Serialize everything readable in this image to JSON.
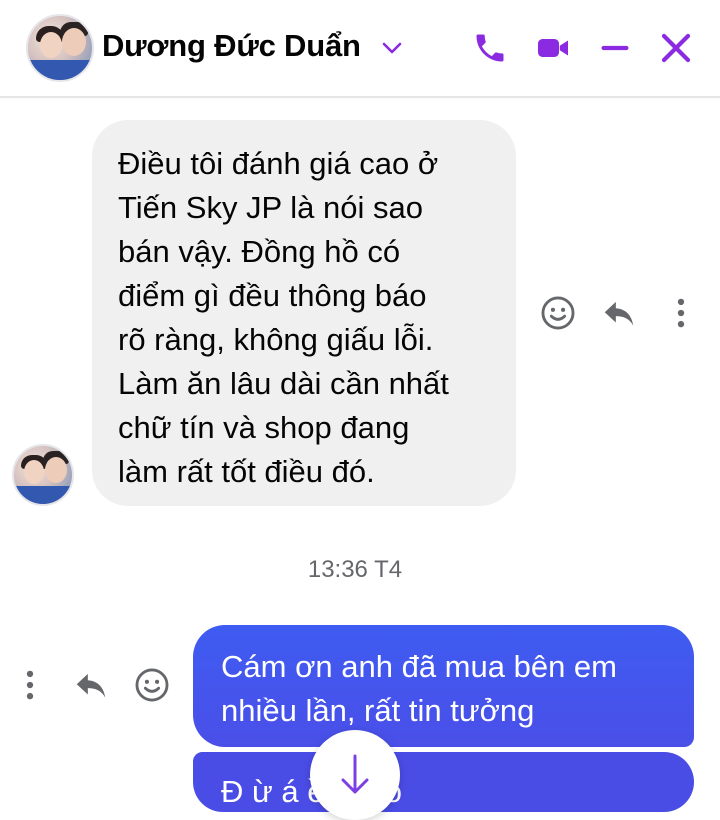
{
  "header": {
    "contact_name": "Dương Đức Duẩn",
    "icons": [
      "phone-icon",
      "video-call-icon",
      "minimize-icon",
      "close-icon"
    ]
  },
  "incoming_message": {
    "lines": [
      "Điều tôi đánh giá cao ở",
      "Tiến Sky JP là nói sao",
      "bán vậy. Đồng hồ có",
      "điểm gì đều thông báo",
      "rõ ràng, không giấu lỗi.",
      "Làm ăn lâu dài cần nhất",
      "chữ tín và shop đang",
      "làm rất tốt điều đó."
    ]
  },
  "timestamp": "13:36 T4",
  "outgoing_message": {
    "lines": [
      "Cám ơn anh đã mua bên em",
      "nhiều lần, rất tin tưởng"
    ]
  },
  "outgoing_message_2": {
    "partial_text": "Đ              ừ   á   ề VN   ỗ"
  },
  "colors": {
    "accent": "#8a2be2",
    "incoming_bubble": "#f0f0f0",
    "outgoing_bubble": "#4459ee",
    "timestamp": "#65676b"
  }
}
